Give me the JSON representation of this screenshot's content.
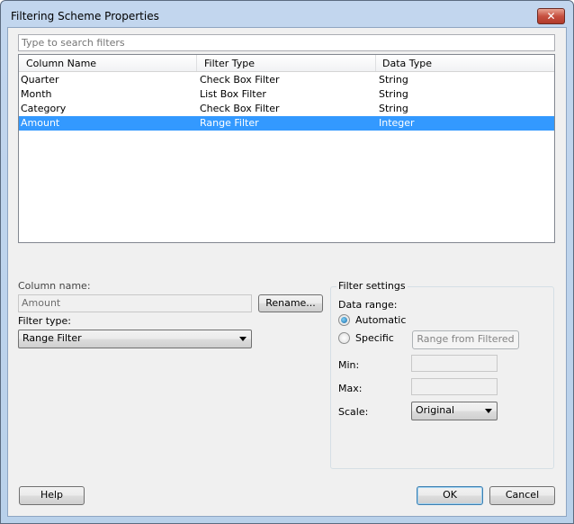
{
  "window": {
    "title": "Filtering Scheme Properties",
    "close_label": "✕"
  },
  "search": {
    "placeholder": "Type to search filters"
  },
  "table": {
    "headers": [
      "Column Name",
      "Filter Type",
      "Data Type"
    ],
    "rows": [
      {
        "column": "Quarter",
        "filter": "Check Box Filter",
        "type": "String"
      },
      {
        "column": "Month",
        "filter": "List Box Filter",
        "type": "String"
      },
      {
        "column": "Category",
        "filter": "Check Box Filter",
        "type": "String"
      },
      {
        "column": "Amount",
        "filter": "Range Filter",
        "type": "Integer",
        "selected": true
      }
    ]
  },
  "left": {
    "column_name_label": "Column name:",
    "column_name_value": "Amount",
    "rename_label": "Rename...",
    "filter_type_label": "Filter type:",
    "filter_type_value": "Range Filter"
  },
  "settings": {
    "title": "Filter settings",
    "data_range_label": "Data range:",
    "automatic_label": "Automatic",
    "specific_label": "Specific",
    "selected_range": "Automatic",
    "range_from_filtered_label": "Range from Filtered",
    "min_label": "Min:",
    "min_value": "",
    "max_label": "Max:",
    "max_value": "",
    "scale_label": "Scale:",
    "scale_value": "Original"
  },
  "footer": {
    "help_label": "Help",
    "ok_label": "OK",
    "cancel_label": "Cancel"
  },
  "colors": {
    "selection": "#3399ff",
    "background": "#f0f0f0"
  }
}
